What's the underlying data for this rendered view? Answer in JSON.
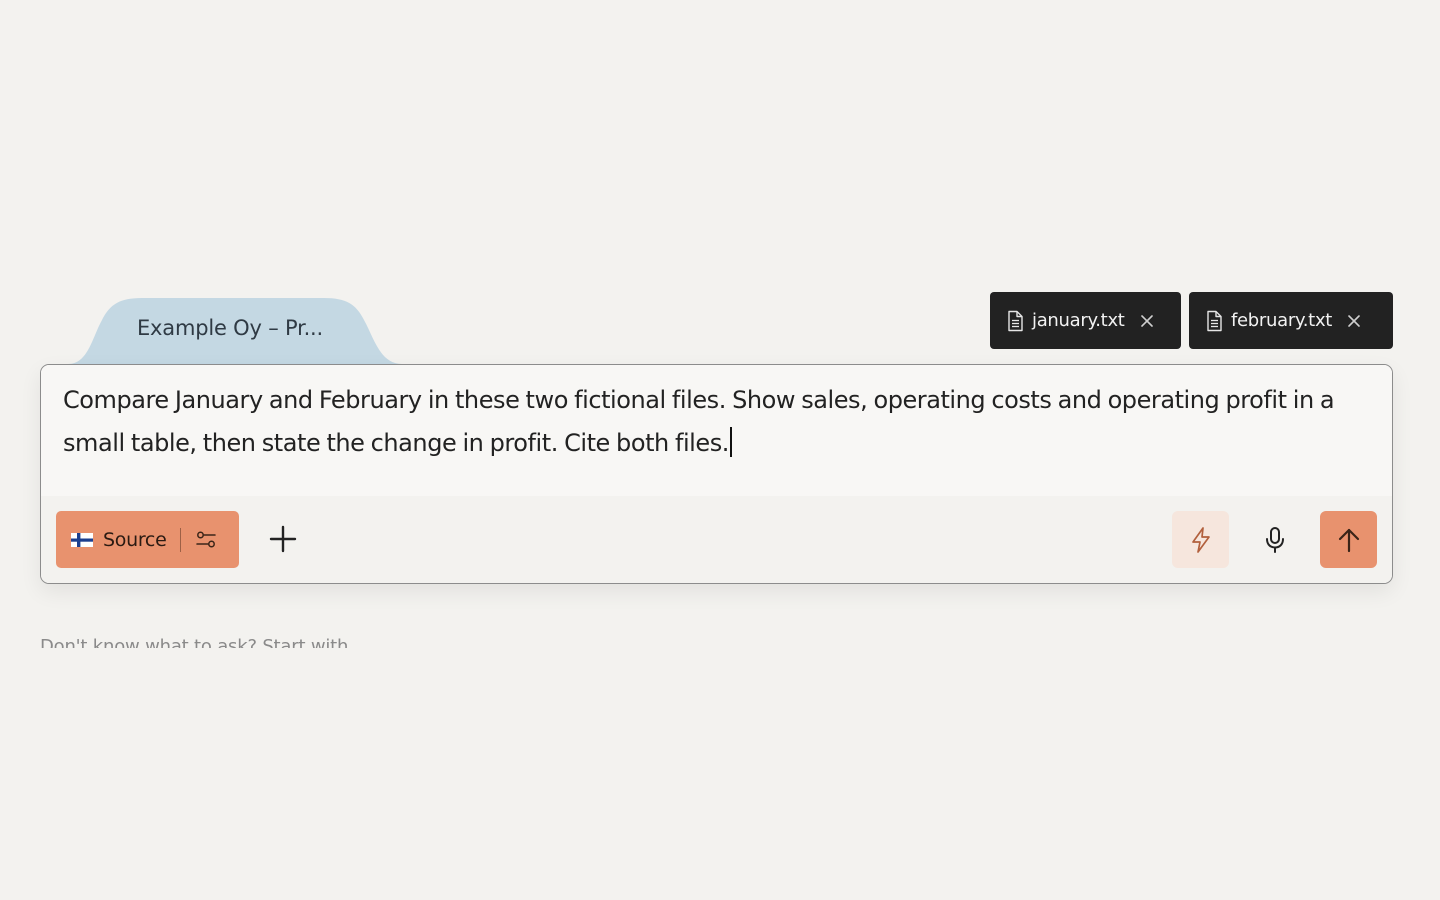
{
  "workspace_tab": {
    "label": "Example Oy – Pr..."
  },
  "attachments": [
    {
      "name": "january.txt",
      "icon": "document-icon",
      "close_icon": "close-icon"
    },
    {
      "name": "february.txt",
      "icon": "document-icon",
      "close_icon": "close-icon"
    }
  ],
  "composer": {
    "prompt": "Compare January and February in these two fictional files. Show sales, operating costs and operating profit in a small table, then state the change in profit. Cite both files."
  },
  "toolbar": {
    "source_label": "Source",
    "source_flag": "finland-flag-icon",
    "settings_icon": "sliders-icon",
    "add_icon": "plus-icon",
    "bolt_icon": "lightning-icon",
    "mic_icon": "microphone-icon",
    "send_icon": "arrow-up-icon"
  },
  "suggestions": {
    "heading": "Don't know what to ask? Start with"
  },
  "colors": {
    "background": "#f3f2ef",
    "accent": "#e8926e",
    "tab": "#c4d8e3",
    "chip": "#222222"
  }
}
